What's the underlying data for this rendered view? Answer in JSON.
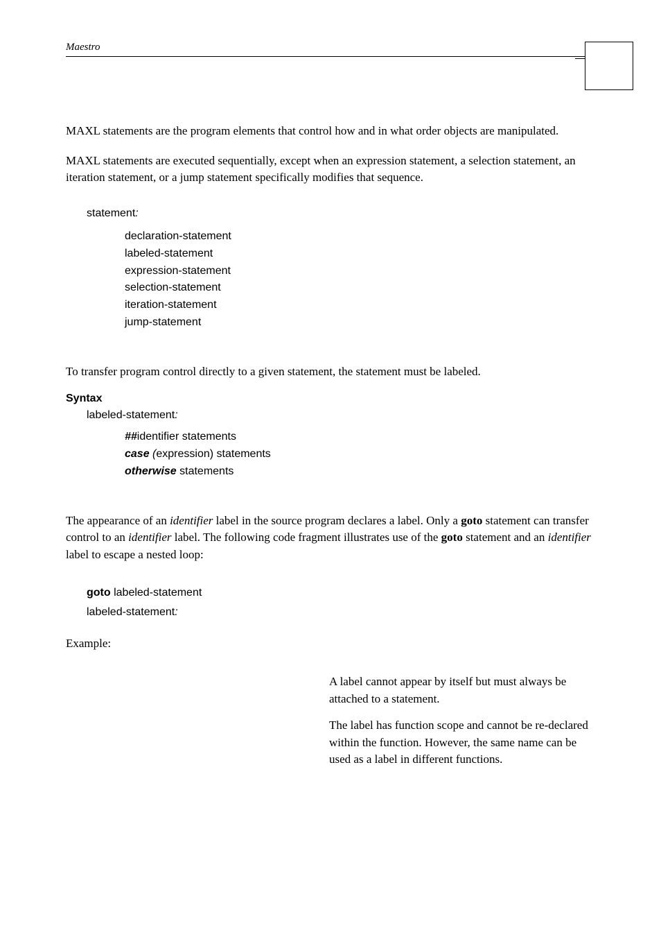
{
  "header": {
    "title": "Maestro"
  },
  "intro1": "MAXL statements are the program elements that control how and in what order objects are manipulated.",
  "intro2": "MAXL statements are executed sequentially, except when an expression statement, a selection statement, an iteration statement, or a jump statement specifically modifies that sequence.",
  "grammar1": {
    "head": "statement",
    "colon": ":",
    "items": [
      "declaration-statement",
      "labeled-statement",
      "expression-statement",
      "selection-statement",
      "iteration-statement",
      "jump-statement"
    ]
  },
  "labeled_intro": "To transfer program control directly to a given statement, the statement must be labeled.",
  "syntax_heading": "Syntax",
  "grammar2": {
    "head": "labeled-statement",
    "colon": ":",
    "line1_kw": "##",
    "line1_rest": "identifier  statements",
    "line2_kw": "case ",
    "line2_open": "(",
    "line2_mid": "expression)  statements",
    "line3_kw": "otherwise",
    "line3_rest": "  statements"
  },
  "appearance_p_pre": "The appearance of an ",
  "identifier_word": "identifier",
  "appearance_p_post1": " label in the source program declares a label. Only a ",
  "goto_word": "goto",
  "appearance_p_post2": " statement can transfer control to an ",
  "appearance_p_post3": " label. The following code fragment illustrates use of the ",
  "appearance_p_post4": " statement and an ",
  "appearance_p_post5": " label to escape a nested loop:",
  "goto_block": {
    "goto_kw": "goto",
    "goto_rest": " labeled-statement",
    "head": "labeled-statement",
    "colon": ":"
  },
  "example_label": "Example:",
  "right_col": {
    "p1": "A label cannot appear by itself but must always be attached to a statement.",
    "p2": "The label has function scope and cannot be re-declared within the function. However, the same name can be used as a label in different functions."
  }
}
